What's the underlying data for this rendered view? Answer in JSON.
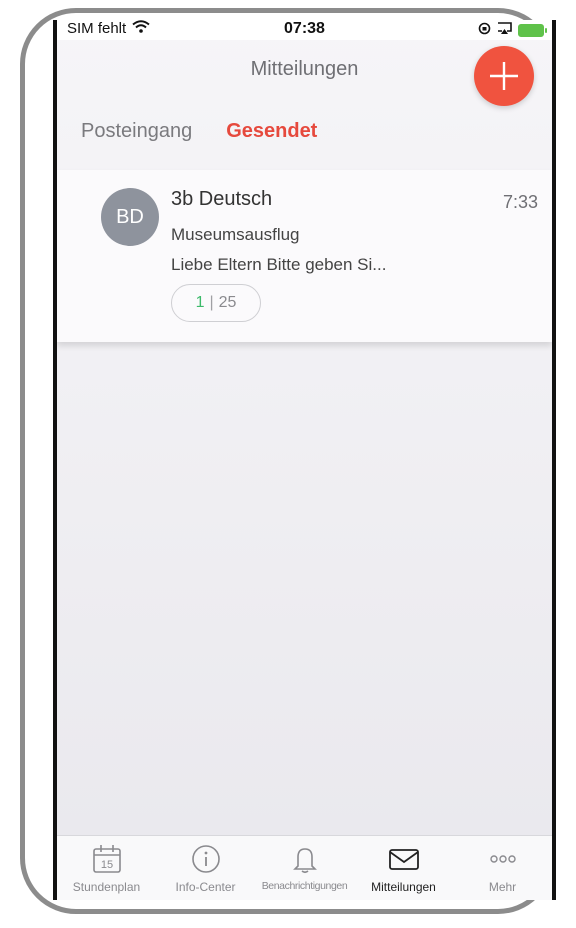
{
  "status_bar": {
    "carrier": "SIM fehlt",
    "time": "07:38"
  },
  "header": {
    "title": "Mitteilungen",
    "compose_icon": "plus-icon",
    "accent_color": "#f0533f"
  },
  "tabs": [
    {
      "label": "Posteingang",
      "active": false
    },
    {
      "label": "Gesendet",
      "active": true
    }
  ],
  "messages": [
    {
      "avatar_initials": "BD",
      "sender": "3b Deutsch",
      "time": "7:33",
      "subject": "Museumsausflug",
      "preview": "Liebe Eltern  Bitte geben Si...",
      "read_count": "1",
      "total_count": "25"
    }
  ],
  "tab_bar": [
    {
      "label": "Stundenplan",
      "icon": "calendar-icon",
      "badge": "15"
    },
    {
      "label": "Info-Center",
      "icon": "info-icon"
    },
    {
      "label": "Benachrichtigungen",
      "icon": "bell-icon"
    },
    {
      "label": "Mitteilungen",
      "icon": "envelope-icon",
      "active": true
    },
    {
      "label": "Mehr",
      "icon": "more-icon"
    }
  ]
}
